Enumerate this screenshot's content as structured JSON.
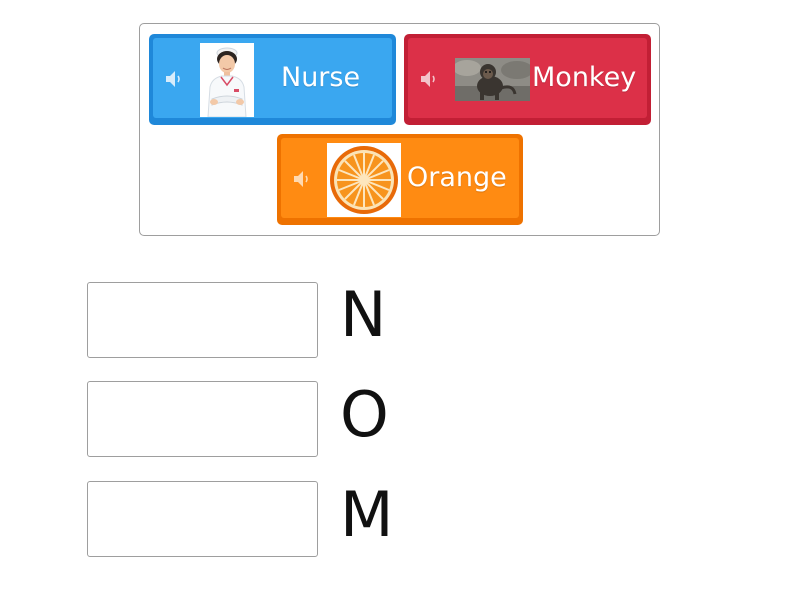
{
  "tiles": [
    {
      "label": "Nurse",
      "image": "nurse-photo",
      "color": "#3aa7f0"
    },
    {
      "label": "Monkey",
      "image": "monkey-photo",
      "color": "#dc3048"
    },
    {
      "label": "Orange",
      "image": "orange-photo",
      "color": "#ff8b12"
    }
  ],
  "icons": {
    "audio": "speaker-icon"
  },
  "clues": [
    {
      "letter": "N",
      "answer": ""
    },
    {
      "letter": "O",
      "answer": ""
    },
    {
      "letter": "M",
      "answer": ""
    }
  ]
}
